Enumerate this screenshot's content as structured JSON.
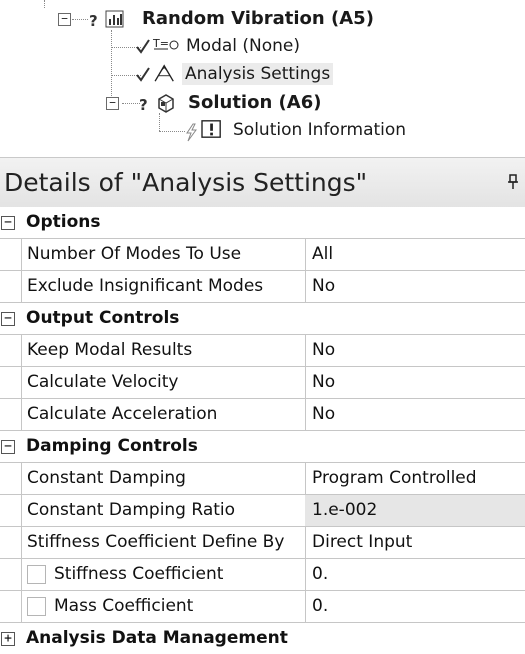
{
  "tree": {
    "random_vibration": {
      "status": "?",
      "label": "Random Vibration (A5)"
    },
    "modal": {
      "label": "Modal (None)"
    },
    "analysis_settings": {
      "label": "Analysis Settings"
    },
    "solution": {
      "status": "?",
      "label": "Solution (A6)"
    },
    "solution_information": {
      "label": "Solution Information"
    }
  },
  "details": {
    "title": "Details of \"Analysis Settings\"",
    "groups": [
      {
        "label": "Options",
        "toggle": "−",
        "rows": [
          {
            "name": "Number Of Modes To Use",
            "value": "All"
          },
          {
            "name": "Exclude Insignificant Modes",
            "value": "No"
          }
        ]
      },
      {
        "label": "Output Controls",
        "toggle": "−",
        "rows": [
          {
            "name": "Keep Modal Results",
            "value": "No"
          },
          {
            "name": "Calculate Velocity",
            "value": "No"
          },
          {
            "name": "Calculate Acceleration",
            "value": "No"
          }
        ]
      },
      {
        "label": "Damping Controls",
        "toggle": "−",
        "rows": [
          {
            "name": "Constant Damping",
            "value": "Program Controlled"
          },
          {
            "name": "Constant Damping Ratio",
            "value": "1.e-002"
          },
          {
            "name": "Stiffness Coefficient Define By",
            "value": "Direct Input"
          },
          {
            "name": "Stiffness Coefficient",
            "value": "0."
          },
          {
            "name": "Mass Coefficient",
            "value": "0."
          }
        ]
      },
      {
        "label": "Analysis Data Management",
        "toggle": "+"
      }
    ]
  }
}
